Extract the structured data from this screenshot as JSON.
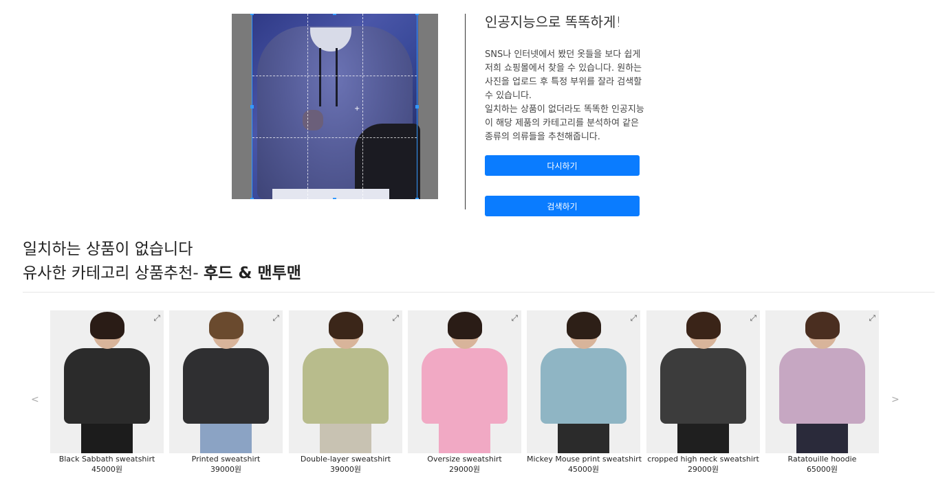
{
  "info": {
    "title": "인공지능으로 똑똑하게!",
    "description": "SNS나 인터넷에서 봤던 옷들을 보다 쉽게\n저희 쇼핑몰에서 찾을 수 있습니다. 원하는\n사진을 업로드 후 특정 부위를 잘라 검색할\n수 있습니다.\n일치하는 상품이 없더라도 똑똑한 인공지능\n이 해당 제품의 카테고리를 분석하여 같은\n종류의 의류들을 추천해줍니다."
  },
  "buttons": {
    "retry": "다시하기",
    "search": "검색하기"
  },
  "result": {
    "no_match": "일치하는 상품이 없습니다",
    "recommend_prefix": "유사한 카테고리 상품추천-",
    "category": "후드 & 맨투맨"
  },
  "carousel": {
    "prev": "<",
    "next": ">"
  },
  "products": [
    {
      "name": "Black Sabbath sweatshirt",
      "price": "45000원",
      "shirt_color": "#2b2b2b",
      "hair_color": "#2a1c16",
      "leg_color": "#1c1c1c"
    },
    {
      "name": "Printed sweatshirt",
      "price": "39000원",
      "shirt_color": "#2f2f31",
      "hair_color": "#6a4a2e",
      "leg_color": "#8ba3c4"
    },
    {
      "name": "Double-layer sweatshirt",
      "price": "39000원",
      "shirt_color": "#b8bc8c",
      "hair_color": "#3b2619",
      "leg_color": "#c8c2b2"
    },
    {
      "name": "Oversize sweatshirt",
      "price": "29000원",
      "shirt_color": "#f1a9c4",
      "hair_color": "#2a1c16",
      "leg_color": "#f1a9c4"
    },
    {
      "name": "Mickey Mouse print sweatshirt",
      "price": "45000원",
      "shirt_color": "#8fb5c4",
      "hair_color": "#2d1f17",
      "leg_color": "#2b2b2b"
    },
    {
      "name": "cropped high neck sweatshirt",
      "price": "29000원",
      "shirt_color": "#3c3c3c",
      "hair_color": "#3a2418",
      "leg_color": "#1f1f1f"
    },
    {
      "name": "Ratatouille hoodie",
      "price": "65000원",
      "shirt_color": "#c6a7c2",
      "hair_color": "#4a2e20",
      "leg_color": "#2a2a3a"
    }
  ],
  "icons": {
    "expand": "expand-icon"
  }
}
